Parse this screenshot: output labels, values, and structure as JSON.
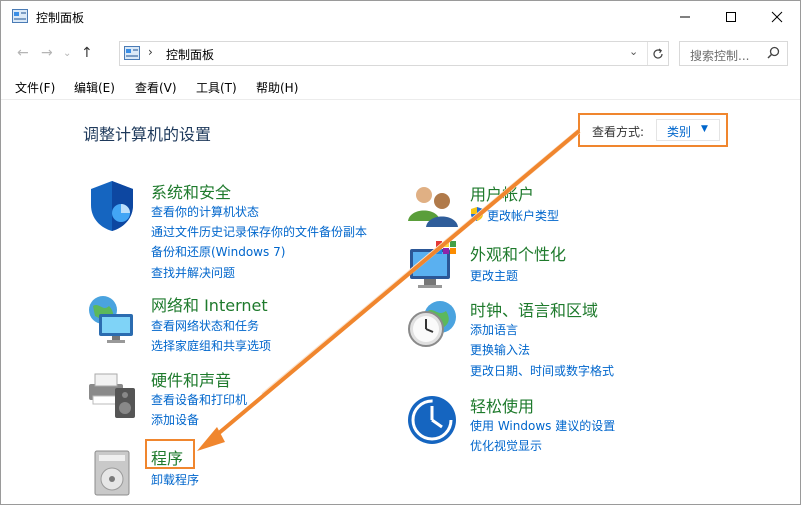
{
  "window": {
    "title": "控制面板"
  },
  "address": {
    "path": "控制面板",
    "search_placeholder": "搜索控制..."
  },
  "menu": {
    "file": "文件(F)",
    "edit": "编辑(E)",
    "view": "查看(V)",
    "tools": "工具(T)",
    "help": "帮助(H)"
  },
  "page": {
    "title": "调整计算机的设置",
    "view_by_label": "查看方式:",
    "view_by_value": "类别"
  },
  "categories": {
    "system": {
      "title": "系统和安全",
      "links": [
        "查看你的计算机状态",
        "通过文件历史记录保存你的文件备份副本",
        "备份和还原(Windows 7)",
        "查找并解决问题"
      ]
    },
    "network": {
      "title": "网络和 Internet",
      "links": [
        "查看网络状态和任务",
        "选择家庭组和共享选项"
      ]
    },
    "hardware": {
      "title": "硬件和声音",
      "links": [
        "查看设备和打印机",
        "添加设备"
      ]
    },
    "programs": {
      "title": "程序",
      "links": [
        "卸载程序"
      ]
    },
    "users": {
      "title": "用户帐户",
      "links": [
        "更改帐户类型"
      ]
    },
    "appearance": {
      "title": "外观和个性化",
      "links": [
        "更改主题"
      ]
    },
    "clock": {
      "title": "时钟、语言和区域",
      "links": [
        "添加语言",
        "更换输入法",
        "更改日期、时间或数字格式"
      ]
    },
    "ease": {
      "title": "轻松使用",
      "links": [
        "使用 Windows 建议的设置",
        "优化视觉显示"
      ]
    }
  },
  "colors": {
    "annotation": "#f0862e",
    "link": "#0066cc",
    "category_title": "#1e7a2c",
    "heading": "#1e395b"
  }
}
